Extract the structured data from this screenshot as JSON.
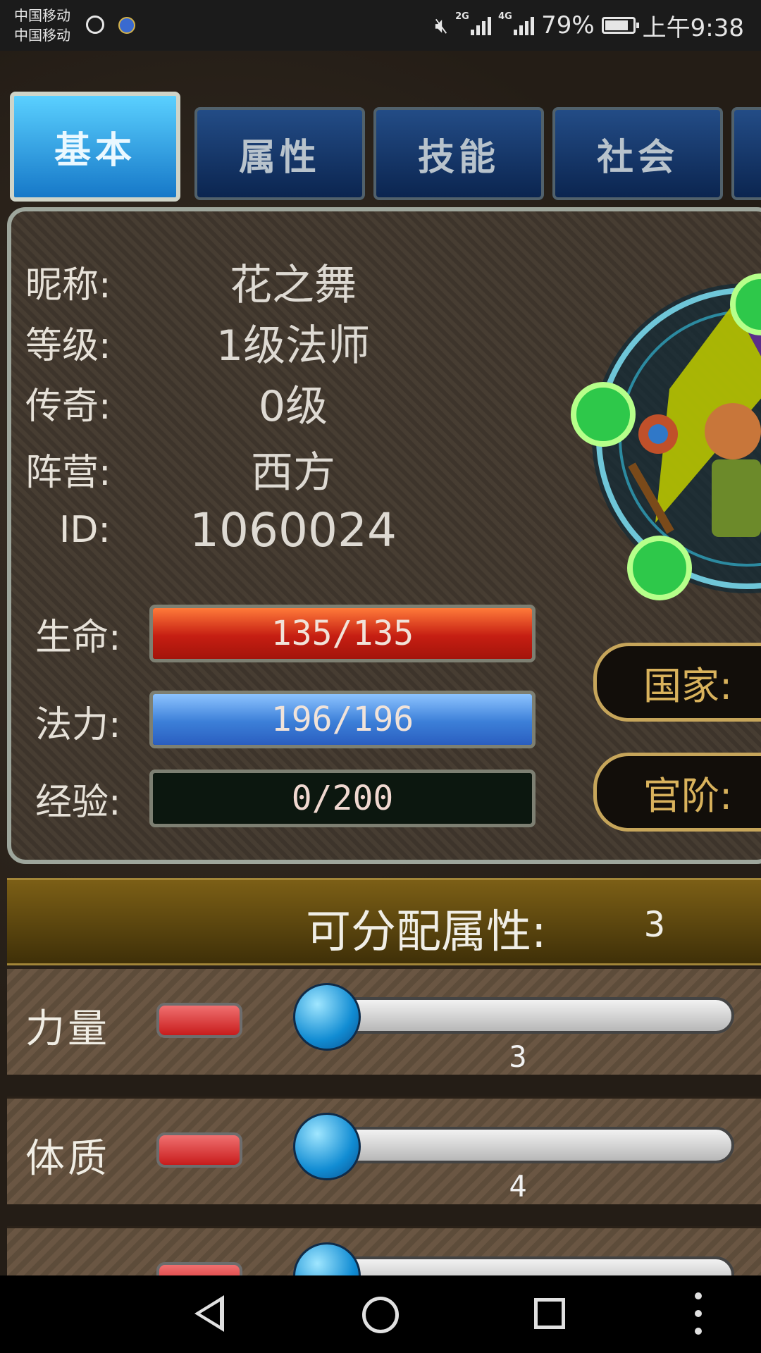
{
  "status_bar": {
    "carrier_1": "中国移动",
    "carrier_2": "中国移动",
    "network_1": "2G",
    "network_2": "4G",
    "battery": "79%",
    "time": "上午9:38"
  },
  "tabs": [
    {
      "label": "基本",
      "active": true
    },
    {
      "label": "属性",
      "active": false
    },
    {
      "label": "技能",
      "active": false
    },
    {
      "label": "社会",
      "active": false
    }
  ],
  "info": {
    "nickname_label": "昵称:",
    "nickname": "花之舞",
    "level_label": "等级:",
    "level": "1级法师",
    "legend_label": "传奇:",
    "legend": "0级",
    "camp_label": "阵营:",
    "camp": "西方",
    "id_label": "ID:",
    "id": "1060024"
  },
  "bars": {
    "hp_label": "生命:",
    "hp_text": "135/135",
    "hp_fraction": 1.0,
    "mp_label": "法力:",
    "mp_text": "196/196",
    "mp_fraction": 1.0,
    "exp_label": "经验:",
    "exp_text": "0/200",
    "exp_fraction": 0.0
  },
  "side": {
    "nation_label": "国家:",
    "rank_label": "官阶:"
  },
  "allocate": {
    "label": "可分配属性:",
    "value": "3"
  },
  "stats": [
    {
      "name": "力量",
      "value": "3"
    },
    {
      "name": "体质",
      "value": "4"
    }
  ],
  "colors": {
    "hp": "#cc2a1a",
    "mp": "#3a7fd6",
    "exp": "#0c170f",
    "tab_active": "#2aa8ec",
    "tab_inactive": "#123a70"
  }
}
